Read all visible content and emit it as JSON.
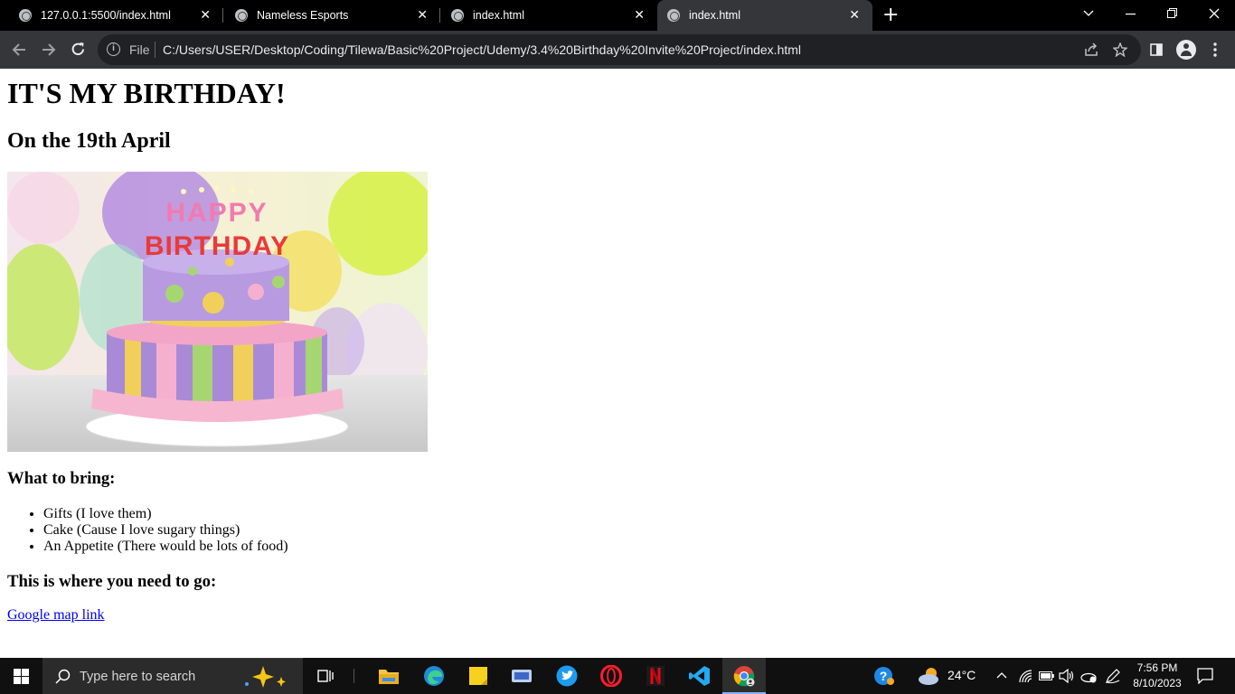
{
  "browser": {
    "tabs": [
      {
        "title": "127.0.0.1:5500/index.html",
        "active": false
      },
      {
        "title": "Nameless Esports",
        "active": false
      },
      {
        "title": "index.html",
        "active": false
      },
      {
        "title": "index.html",
        "active": true
      }
    ],
    "close_glyph": "✕",
    "new_tab_glyph": "+",
    "address": {
      "scheme_label": "File",
      "url": "C:/Users/USER/Desktop/Coding/Tilewa/Basic%20Project/Udemy/3.4%20Birthday%20Invite%20Project/index.html"
    }
  },
  "page": {
    "heading": "IT'S MY BIRTHDAY!",
    "date_line": "On the 19th April",
    "cake_text": "HAPPY BIRTHDAY",
    "bring_heading": "What to bring:",
    "bring_items": [
      "Gifts (I love them)",
      "Cake (Cause I love sugary things)",
      "An Appetite (There would be lots of food)"
    ],
    "go_heading": "This is where you need to go:",
    "map_link": "Google map link"
  },
  "taskbar": {
    "search_placeholder": "Type here to search",
    "weather": "24°C",
    "time": "7:56 PM",
    "date": "8/10/2023"
  }
}
